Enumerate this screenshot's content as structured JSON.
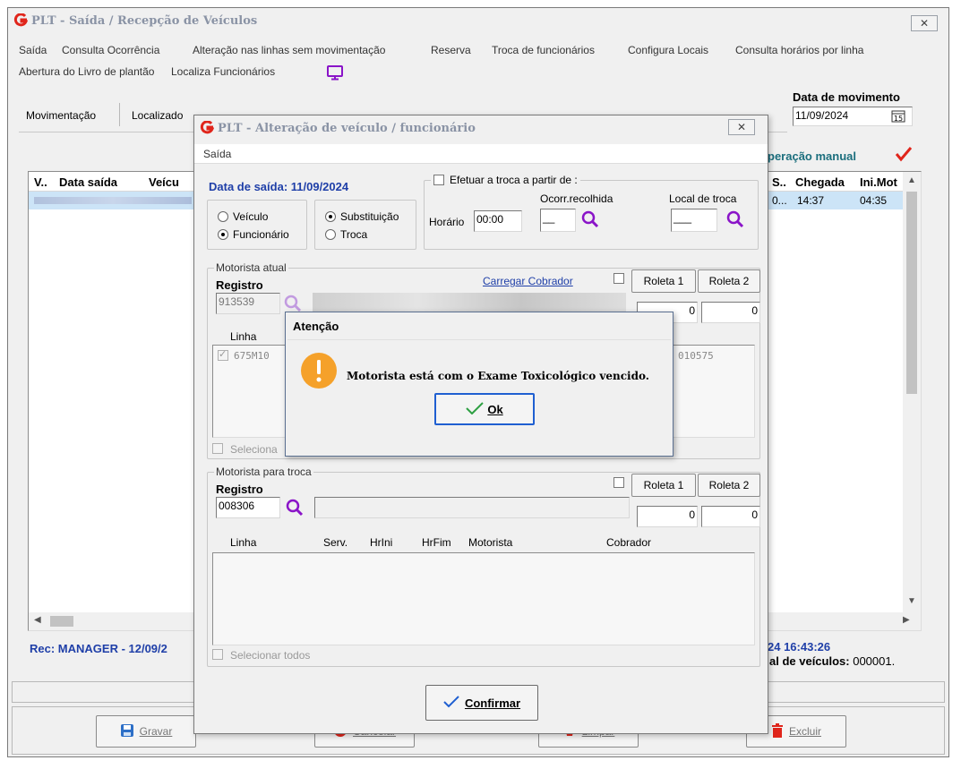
{
  "main": {
    "title": "PLT - Saída / Recepção de Veículos",
    "menu_row1": [
      "Saída",
      "Consulta Ocorrência",
      "Alteração nas linhas sem movimentação",
      "Reserva",
      "Troca de funcionários",
      "Configura Locais",
      "Consulta horários por linha"
    ],
    "menu_row2": [
      "Abertura do Livro de plantão",
      "Localiza Funcionários"
    ],
    "tabs": [
      "Movimentação",
      "Localizado"
    ],
    "data_movimento_label": "Data de movimento",
    "data_movimento_value": "11/09/2024",
    "operacao_manual": "peração manual",
    "grid_headers_left": [
      "V..",
      "Data saída",
      "Veícu"
    ],
    "grid_headers_right": [
      "S..",
      "Chegada",
      "Ini.Mot"
    ],
    "grid_row_right": [
      "0...",
      "14:37",
      "04:35"
    ],
    "rec_label": "Rec: MANAGER - 12/09/2",
    "time_label": "24 16:43:26",
    "total_label": "al de veículos:",
    "total_value": "000001.",
    "buttons": {
      "gravar": "Gravar",
      "excluir": "Excluir",
      "cancelar": "Cancelar",
      "limpar": "Limpar"
    }
  },
  "dialog": {
    "title": "PLT - Alteração de veículo / funcionário",
    "menu": "Saída",
    "data_saida": "Data de saída: 11/09/2024",
    "radio_veiculo": "Veículo",
    "radio_funcionario": "Funcionário",
    "radio_substituicao": "Substituição",
    "radio_troca": "Troca",
    "efetuar_troca": "Efetuar a troca a partir de :",
    "horario_label": "Horário",
    "horario_value": "00:00",
    "ocorr_label": "Ocorr.recolhida",
    "local_troca_label": "Local de troca",
    "motorista_atual_legend": "Motorista atual",
    "registro_label": "Registro",
    "registro_atual": "913539",
    "carregar_cobrador": "Carregar Cobrador",
    "roleta1": "Roleta 1",
    "roleta2": "Roleta 2",
    "roleta_atual_values": [
      "0",
      "0"
    ],
    "linha_label": "Linha",
    "linha_atual_value": "675M10",
    "linha_atual_suffix": "010575",
    "selecionar_todos_short": "Seleciona",
    "motorista_troca_legend": "Motorista para troca",
    "registro_troca": "008306",
    "roleta_troca_values": [
      "0",
      "0"
    ],
    "cols": [
      "Linha",
      "Serv.",
      "HrIni",
      "HrFim",
      "Motorista",
      "Cobrador"
    ],
    "selecionar_todos": "Selecionar todos",
    "confirmar": "Confirmar"
  },
  "alert": {
    "title": "Atenção",
    "message": "Motorista está com o Exame Toxicológico vencido.",
    "ok": "Ok"
  },
  "colors": {
    "accent_red": "#e0251b",
    "link_blue": "#1f3fa8",
    "magnifier_purple": "#8a14c8",
    "selection_blue": "#cce4f7",
    "warning_orange": "#f5a12a",
    "ok_green": "#2ea043"
  }
}
